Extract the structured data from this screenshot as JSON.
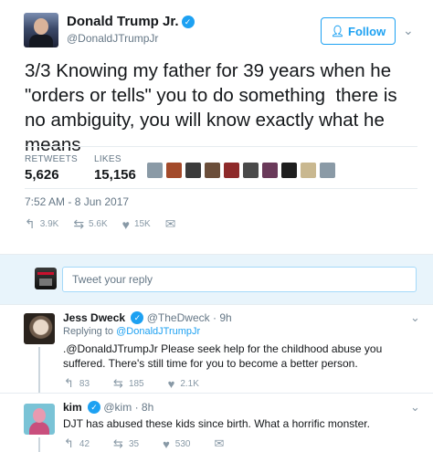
{
  "tweet": {
    "name": "Donald Trump Jr.",
    "handle": "@DonaldJTrumpJr",
    "follow_label": "Follow",
    "text": "3/3 Knowing my father for 39 years when he \"orders or tells\" you to do something  there is no ambiguity, you will know exactly what he means",
    "retweets_label": "RETWEETS",
    "retweets": "5,626",
    "likes_label": "LIKES",
    "likes": "15,156",
    "timestamp": "7:52 AM - 8 Jun 2017",
    "reply_count": "3.9K",
    "retweet_count": "5.6K",
    "like_count": "15K"
  },
  "likers": [
    "#8a9aa6",
    "#a34a2a",
    "#3b3b3b",
    "#6b4e3a",
    "#8e2a2a",
    "#4a4a4a",
    "#6a3a5a",
    "#1e1e1e",
    "#c9b890",
    "#8a9aa6"
  ],
  "reply_box": {
    "placeholder": "Tweet your reply"
  },
  "replies": [
    {
      "name": "Jess Dweck",
      "handle": "@TheDweck",
      "time": "9h",
      "replying_prefix": "Replying to",
      "replying_to": "@DonaldJTrumpJr",
      "text": ".@DonaldJTrumpJr Please seek help for the childhood abuse you suffered. There's still time for you to become a better person.",
      "replies": "83",
      "retweets": "185",
      "likes": "2.1K"
    },
    {
      "name": "kim",
      "handle": "@kim",
      "time": "8h",
      "text": "DJT has abused these kids since birth. What a horrific monster.",
      "replies": "42",
      "retweets": "35",
      "likes": "530"
    }
  ],
  "colors": {
    "accent": "#1da1f2",
    "muted": "#657786",
    "reply_bar": "#e8f4fb"
  },
  "icons": {
    "verified": "verified-badge-icon",
    "follow": "add-person-icon",
    "chevron": "chevron-down-icon",
    "reply": "reply-icon",
    "retweet": "retweet-icon",
    "like": "heart-icon",
    "dm": "envelope-icon"
  }
}
